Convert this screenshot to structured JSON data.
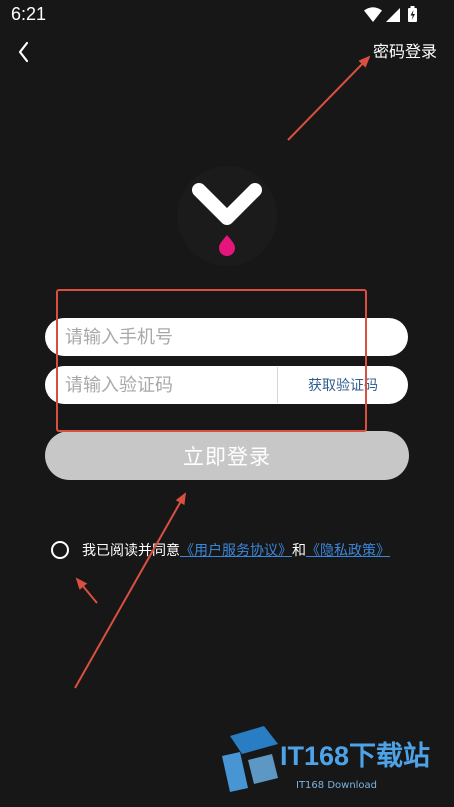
{
  "status_bar": {
    "time": "6:21",
    "icons": [
      "wifi-icon",
      "signal-icon",
      "battery-icon"
    ]
  },
  "header": {
    "back_icon": "back-arrow-icon",
    "password_login_label": "密码登录"
  },
  "logo": {
    "icon": "app-logo-icon",
    "colors": {
      "mark": "#ffffff",
      "dot": "#e5157b",
      "circle": "#1b1b1b"
    }
  },
  "form": {
    "phone_placeholder": "请输入手机号",
    "code_placeholder": "请输入验证码",
    "get_code_label": "获取验证码",
    "login_button_label": "立即登录"
  },
  "agreement": {
    "checked": false,
    "prefix": "我已阅读并同意",
    "service_link": "《用户服务协议》",
    "conjunction": "和",
    "privacy_link": "《隐私政策》"
  },
  "annotations": {
    "color": "#d95040"
  },
  "watermark": {
    "brand": "IT168下载站",
    "sub": "IT168 Download"
  },
  "theme": {
    "background": "#171717",
    "input_background": "#ffffff",
    "placeholder": "#a8a8a8",
    "button_disabled": "#c7c7c7",
    "link": "#3b86d9",
    "get_code_text": "#2f5d8d"
  }
}
